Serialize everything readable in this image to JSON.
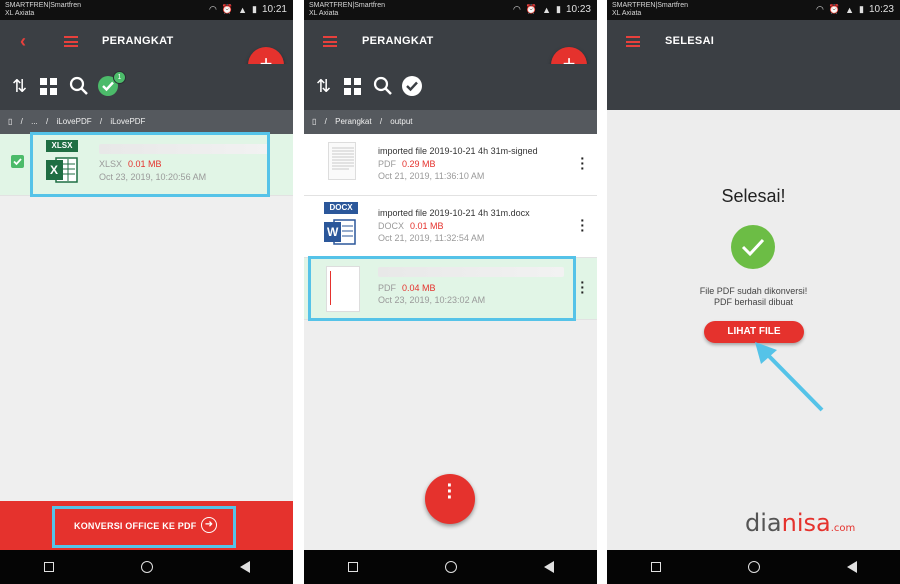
{
  "status": {
    "carrier1": "SMARTFREN|Smartfren",
    "carrier2": "XL Axiata",
    "times": [
      "10:21",
      "10:23",
      "10:23"
    ]
  },
  "panel1": {
    "title": "PERANGKAT",
    "badge": "1",
    "breadcrumb": [
      "...",
      "iLovePDF",
      "iLovePDF"
    ],
    "file": {
      "badge": "XLSX",
      "icon_letter": "X",
      "type": "XLSX",
      "size": "0.01 MB",
      "date": "Oct 23, 2019, 10:20:56 AM"
    },
    "convert_label": "KONVERSI OFFICE KE PDF"
  },
  "panel2": {
    "title": "PERANGKAT",
    "breadcrumb": [
      "Perangkat",
      "output"
    ],
    "files": [
      {
        "name": "imported file 2019-10-21 4h 31m-signed",
        "type": "PDF",
        "size": "0.29 MB",
        "date": "Oct 21, 2019, 11:36:10 AM"
      },
      {
        "badge": "DOCX",
        "icon_letter": "W",
        "name": "imported file 2019-10-21 4h 31m.docx",
        "type": "DOCX",
        "size": "0.01 MB",
        "date": "Oct 21, 2019, 11:32:54 AM"
      },
      {
        "name": "",
        "type": "PDF",
        "size": "0.04 MB",
        "date": "Oct 23, 2019, 10:23:02 AM"
      }
    ]
  },
  "panel3": {
    "title": "SELESAI",
    "heading": "Selesai!",
    "msg1": "File PDF sudah dikonversi!",
    "msg2": "PDF berhasil dibuat",
    "button": "LIHAT FILE"
  },
  "watermark": {
    "part1": "dia",
    "part2": "nisa",
    "part3": ".com"
  },
  "colors": {
    "accent": "#e5322d",
    "appbar": "#3b3f44",
    "success": "#5cb85c",
    "highlight": "#55c3e8"
  }
}
